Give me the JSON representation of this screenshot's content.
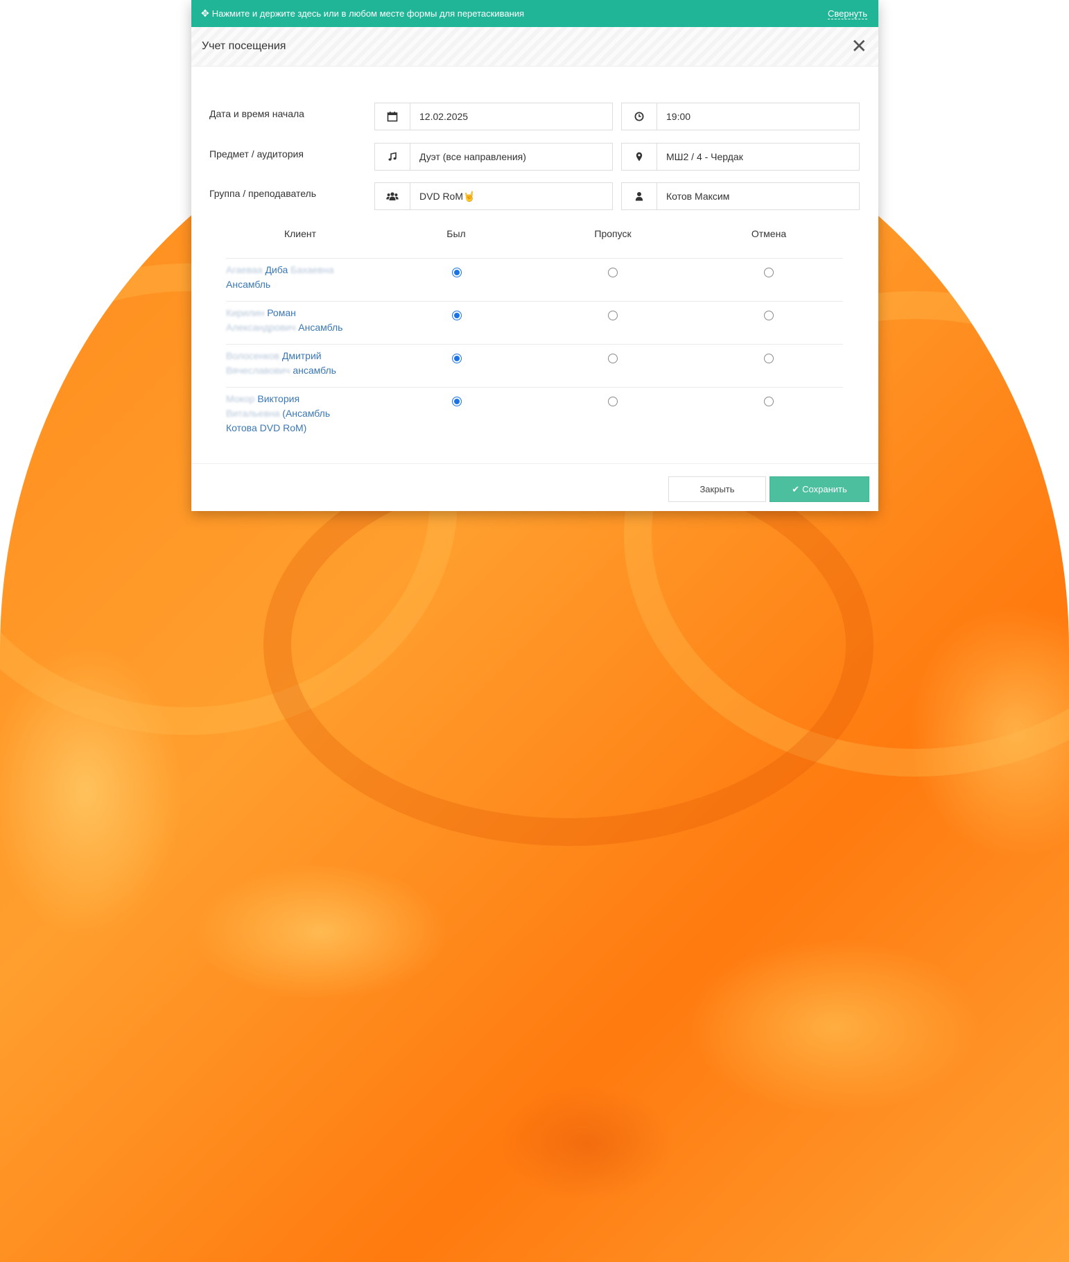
{
  "dragbar": {
    "hint": "Нажмите и держите здесь или в любом месте формы для перетаскивания",
    "collapse": "Свернуть",
    "icon": "move-icon"
  },
  "modal": {
    "title": "Учет посещения",
    "close_icon": "close-icon"
  },
  "form": {
    "start": {
      "label": "Дата и время начала",
      "date": "12.02.2025",
      "time": "19:00",
      "date_icon": "calendar-icon",
      "time_icon": "clock-icon"
    },
    "subject": {
      "label": "Предмет / аудитория",
      "subject": "Дуэт (все направления)",
      "room": "МШ2 / 4 - Чердак",
      "subject_icon": "music-note-icon",
      "room_icon": "map-marker-icon"
    },
    "group": {
      "label": "Группа / преподаватель",
      "group": "DVD RoM",
      "group_emoji": "🤘",
      "teacher": "Котов Максим",
      "group_icon": "users-icon",
      "teacher_icon": "user-icon"
    }
  },
  "table": {
    "headers": {
      "client": "Клиент",
      "present": "Был",
      "absent": "Пропуск",
      "cancel": "Отмена"
    },
    "rows": [
      {
        "blur1": "Агаеваа",
        "name": "Диба",
        "blur2": "Бахаевна",
        "line2": "Ансамбль",
        "line3": "",
        "status": "present"
      },
      {
        "blur1": "Кирилин",
        "name": "Роман",
        "blur2": "Александрович",
        "line2": "Ансамбль",
        "line3": "",
        "status": "present"
      },
      {
        "blur1": "Волосенков",
        "name": "Дмитрий",
        "blur2": "Вячеславович",
        "line2": "ансамбль",
        "line3": "",
        "status": "present"
      },
      {
        "blur1": "Мокор",
        "name": "Виктория",
        "blur2": "Витальевна",
        "line2": "(Ансамбль",
        "line3": "Котова DVD RoM)",
        "status": "present"
      }
    ]
  },
  "footer": {
    "close": "Закрыть",
    "save": "Сохранить",
    "save_icon": "check-icon"
  },
  "colors": {
    "accent": "#1fb596",
    "save": "#4cbf9f",
    "link": "#3a77b5",
    "radio": "#1a73e8"
  }
}
